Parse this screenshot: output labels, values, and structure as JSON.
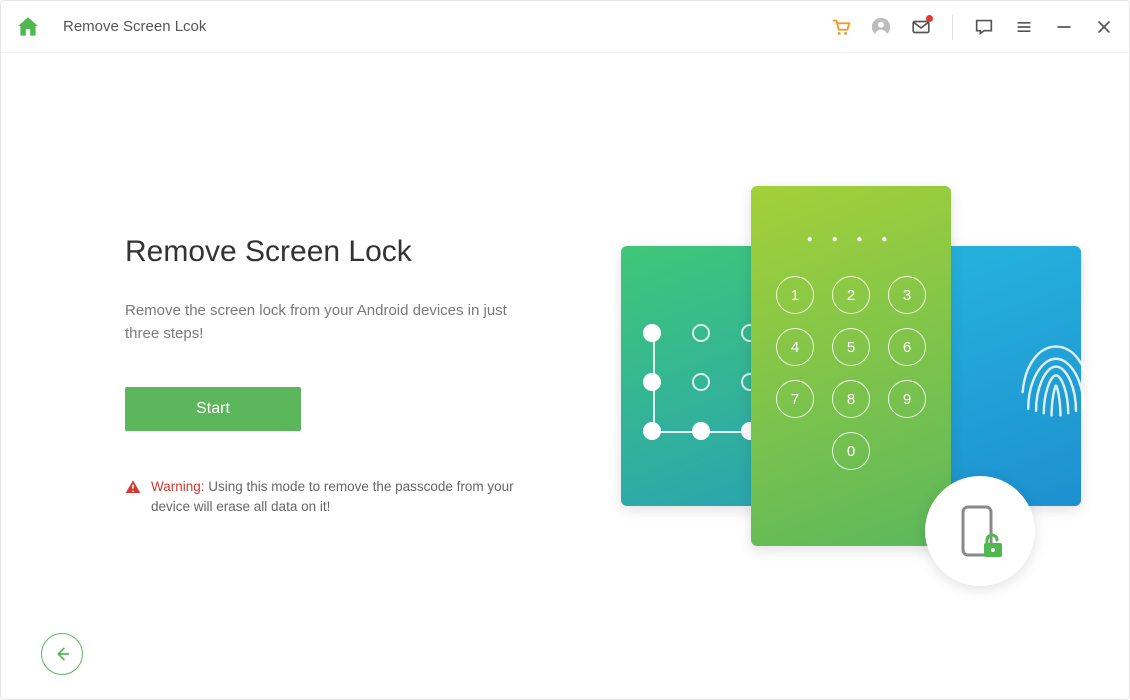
{
  "titlebar": {
    "title": "Remove Screen Lcok"
  },
  "main": {
    "heading": "Remove Screen Lock",
    "description": "Remove the screen lock from your Android devices in just three steps!",
    "start_label": "Start",
    "warning_label": "Warning:",
    "warning_text": " Using this mode to remove the passcode from your device will erase all data on it!"
  },
  "keypad": {
    "keys": [
      "1",
      "2",
      "3",
      "4",
      "5",
      "6",
      "7",
      "8",
      "9",
      "0"
    ]
  },
  "colors": {
    "accent": "#5cb65c",
    "warn": "#d43a2f",
    "cart": "#f39a2a"
  }
}
